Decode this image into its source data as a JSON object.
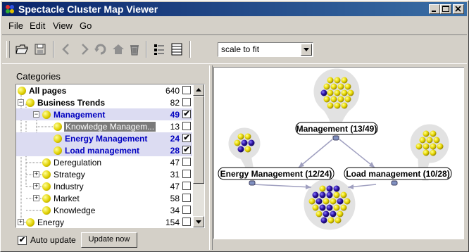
{
  "window": {
    "title": "Spectacle Cluster Map Viewer"
  },
  "menu": [
    "File",
    "Edit",
    "View",
    "Go"
  ],
  "toolbar": {
    "icons": [
      "open-folder-icon",
      "save-disk-icon",
      "back-arrow-icon",
      "forward-arrow-icon",
      "refresh-icon",
      "home-icon",
      "trash-icon",
      "tree-view-icon",
      "list-view-icon"
    ],
    "zoom_select": "scale to fit"
  },
  "categories": {
    "label": "Categories",
    "rows": [
      {
        "label": "All pages",
        "count": "640",
        "checked": false
      },
      {
        "label": "Business Trends",
        "count": "82",
        "checked": false
      },
      {
        "label": "Management",
        "count": "49",
        "checked": true
      },
      {
        "label": "Knowledge Managem...",
        "count": "13",
        "checked": false
      },
      {
        "label": "Energy Management",
        "count": "24",
        "checked": true
      },
      {
        "label": "Load management",
        "count": "28",
        "checked": true
      },
      {
        "label": "Deregulation",
        "count": "47",
        "checked": false
      },
      {
        "label": "Strategy",
        "count": "31",
        "checked": false
      },
      {
        "label": "Industry",
        "count": "47",
        "checked": false
      },
      {
        "label": "Market",
        "count": "58",
        "checked": false
      },
      {
        "label": "Knowledge",
        "count": "34",
        "checked": false
      },
      {
        "label": "Energy",
        "count": "154",
        "checked": false
      }
    ]
  },
  "controls": {
    "auto_update_label": "Auto update",
    "auto_update_checked": true,
    "update_now_label": "Update now"
  },
  "cluster_map": {
    "nodes": [
      {
        "label": "Management (13/49)"
      },
      {
        "label": "Energy Management (12/24)"
      },
      {
        "label": "Load management (10/28)"
      }
    ]
  },
  "colors": {
    "title_gradient_start": "#0a246a",
    "title_gradient_end": "#3a6ea5",
    "selected_text": "#0000c0",
    "doc_yellow": "#e8d800",
    "doc_blue": "#2a0fa0",
    "cluster_bg": "#e2e2e2"
  }
}
